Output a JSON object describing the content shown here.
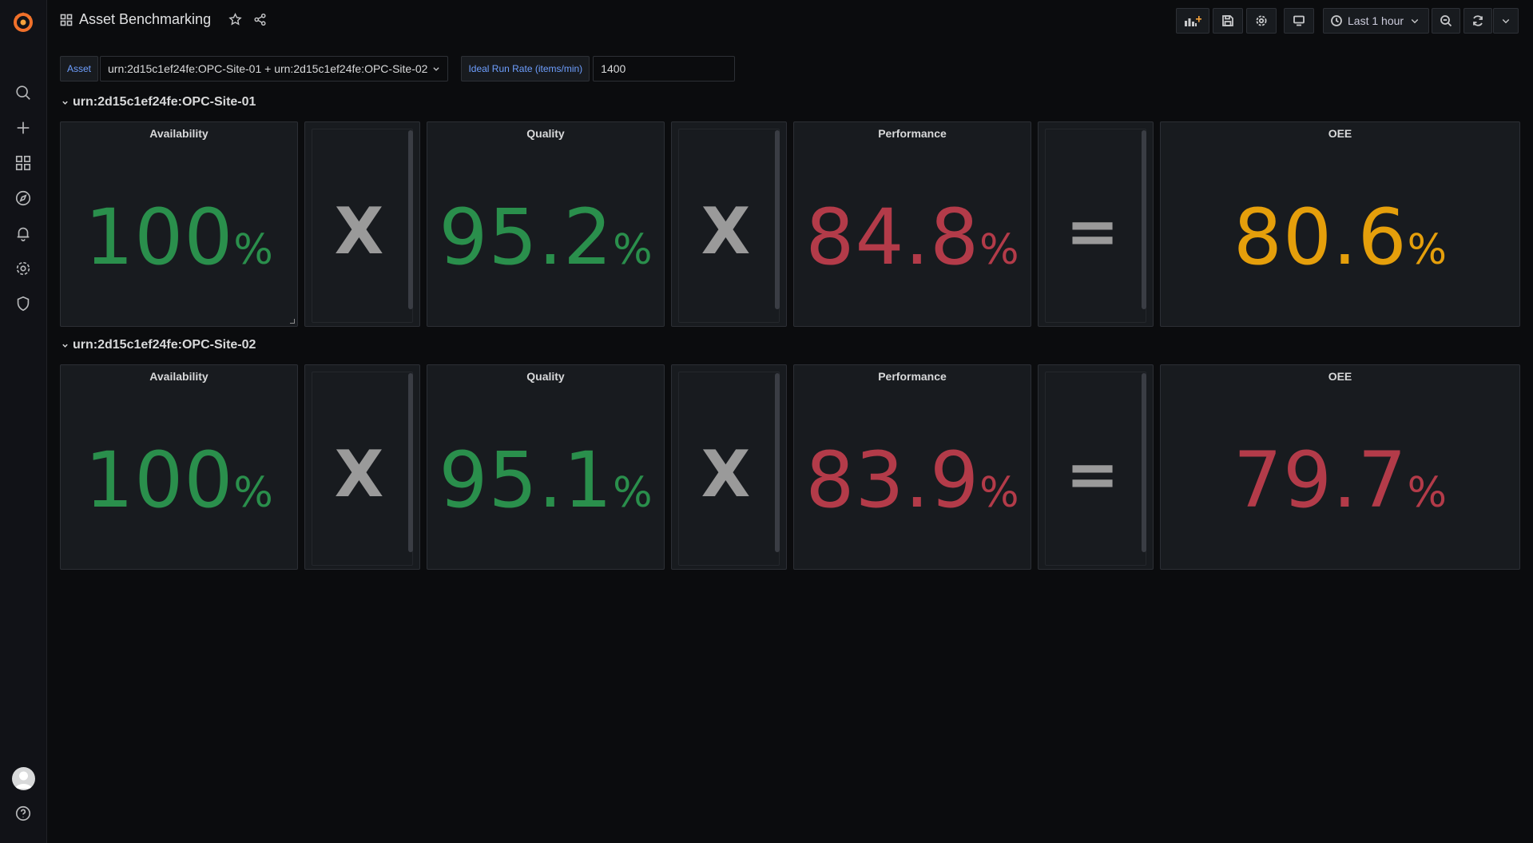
{
  "dashboard": {
    "title": "Asset Benchmarking"
  },
  "toolbar": {
    "time_range": "Last 1 hour"
  },
  "variables": {
    "asset_label": "Asset",
    "asset_value": "urn:2d15c1ef24fe:OPC-Site-01 + urn:2d15c1ef24fe:OPC-Site-02",
    "run_rate_label": "Ideal Run Rate (items/min)",
    "run_rate_value": "1400"
  },
  "rows": [
    {
      "title": "urn:2d15c1ef24fe:OPC-Site-01",
      "availability": {
        "title": "Availability",
        "value": "100",
        "unit": "%",
        "color": "#2a8f4c"
      },
      "op1": "X",
      "quality": {
        "title": "Quality",
        "value": "95.2",
        "unit": "%",
        "color": "#2a8f4c"
      },
      "op2": "X",
      "performance": {
        "title": "Performance",
        "value": "84.8",
        "unit": "%",
        "color": "#b33b49"
      },
      "op3": "=",
      "oee": {
        "title": "OEE",
        "value": "80.6",
        "unit": "%",
        "color": "#e59f0b"
      }
    },
    {
      "title": "urn:2d15c1ef24fe:OPC-Site-02",
      "availability": {
        "title": "Availability",
        "value": "100",
        "unit": "%",
        "color": "#2a8f4c"
      },
      "op1": "X",
      "quality": {
        "title": "Quality",
        "value": "95.1",
        "unit": "%",
        "color": "#2a8f4c"
      },
      "op2": "X",
      "performance": {
        "title": "Performance",
        "value": "83.9",
        "unit": "%",
        "color": "#b33b49"
      },
      "op3": "=",
      "oee": {
        "title": "OEE",
        "value": "79.7",
        "unit": "%",
        "color": "#b33b49"
      }
    }
  ]
}
